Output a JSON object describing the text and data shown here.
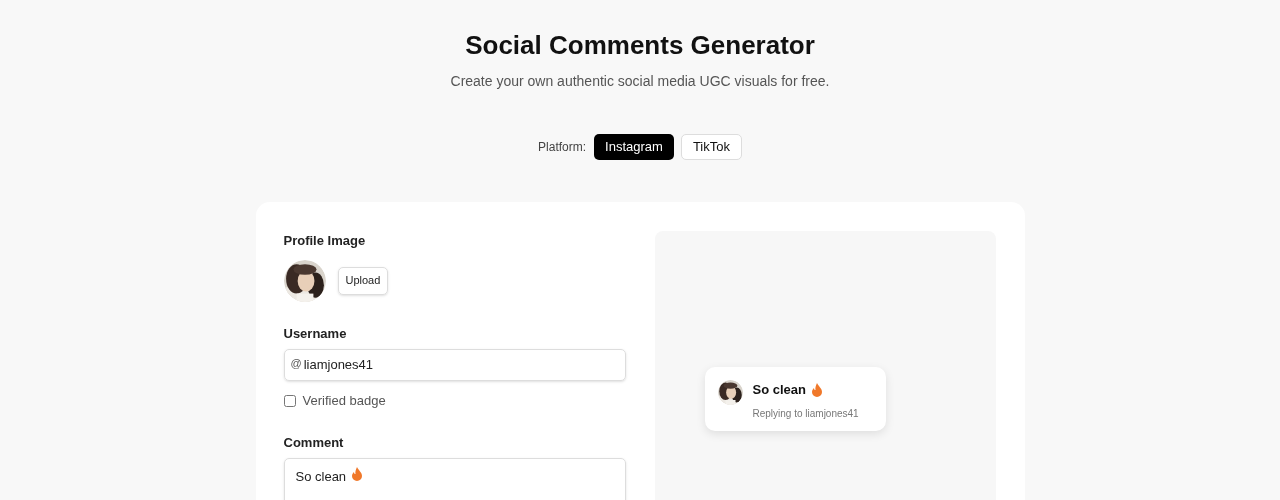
{
  "header": {
    "title": "Social Comments Generator",
    "subtitle": "Create your own authentic social media UGC visuals for free."
  },
  "platform": {
    "label": "Platform:",
    "options": [
      {
        "label": "Instagram",
        "selected": true
      },
      {
        "label": "TikTok",
        "selected": false
      }
    ]
  },
  "form": {
    "profile_image": {
      "label": "Profile Image",
      "button": "Upload"
    },
    "username": {
      "label": "Username",
      "prefix": "@",
      "value": "liamjones41"
    },
    "verified": {
      "label": "Verified badge",
      "checked": false
    },
    "comment": {
      "label": "Comment",
      "value": "So clean"
    }
  },
  "preview": {
    "comment": "So clean",
    "reply": "Replying to liamjones41"
  }
}
